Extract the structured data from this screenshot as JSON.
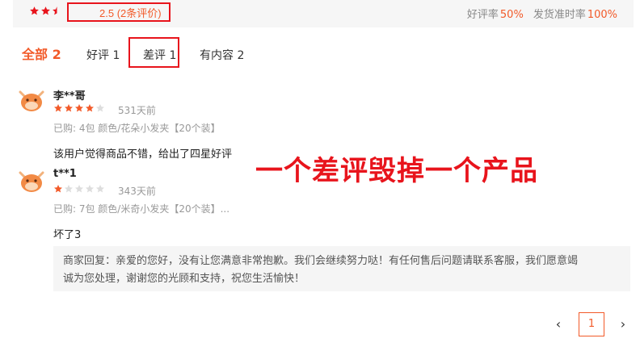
{
  "summary": {
    "rating": 2.5,
    "score_text": "2.5",
    "count_text": "(2条评价)",
    "good_rate_label": "好评率",
    "good_rate_value": "50%",
    "ship_rate_label": "发货准时率",
    "ship_rate_value": "100%"
  },
  "tabs": [
    {
      "label": "全部 2",
      "active": true
    },
    {
      "label": "好评 1",
      "active": false
    },
    {
      "label": "差评 1",
      "active": false
    },
    {
      "label": "有内容 2",
      "active": false
    }
  ],
  "reviews": [
    {
      "user": "李**哥",
      "rating": 4,
      "days": "531天前",
      "spec": "已购: 4包 颜色/花朵小发夹【20个装】",
      "text": "该用户觉得商品不错，给出了四星好评"
    },
    {
      "user": "t**1",
      "rating": 1,
      "days": "343天前",
      "spec": "已购: 7包 颜色/米奇小发夹【20个装】...",
      "text": "坏了3",
      "reply_line1": "商家回复：亲爱的您好，没有让您满意非常抱歉。我们会继续努力哒！有任何售后问题请联系客服，我们愿意竭",
      "reply_line2": "诚为您处理，谢谢您的光顾和支持，祝您生活愉快！"
    }
  ],
  "overlay_text": "一个差评毁掉一个产品",
  "pager": {
    "current": "1",
    "prev_icon": "chevron-left-icon",
    "next_icon": "chevron-right-icon"
  },
  "colors": {
    "accent": "#f25a29",
    "highlight_red": "#e8141c",
    "star_off": "#dddddd"
  }
}
